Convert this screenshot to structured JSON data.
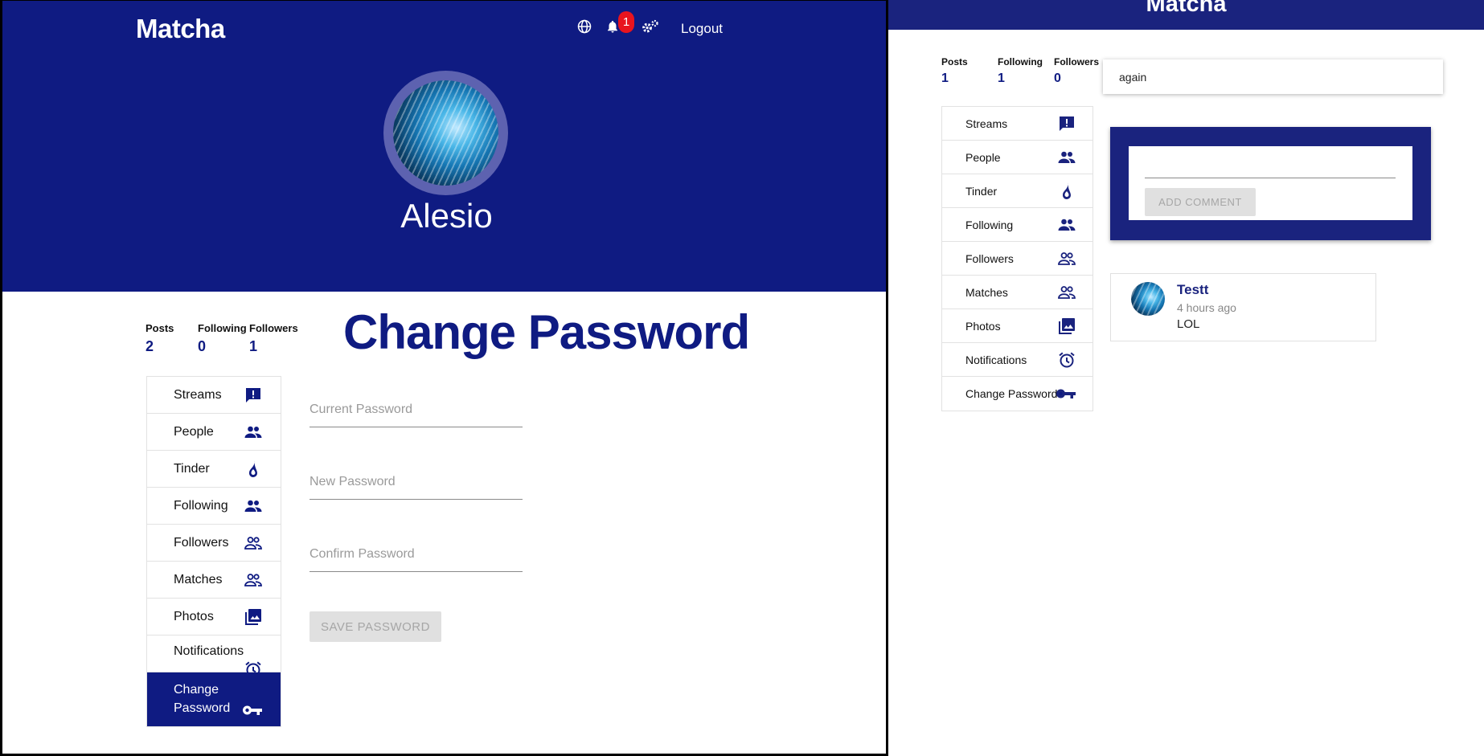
{
  "colors": {
    "primary": "#0f1b82",
    "primary_alt": "#1a237e",
    "badge": "#e8141e",
    "disabled_bg": "#e0e0e0"
  },
  "left": {
    "header": {
      "brand": "Matcha",
      "icons": [
        "globe-icon",
        "bell-icon",
        "settings-icon"
      ],
      "notification_count": "1",
      "logout_label": "Logout"
    },
    "profile": {
      "username": "Alesio"
    },
    "stats": {
      "posts_label": "Posts",
      "posts_value": "2",
      "following_label": "Following",
      "following_value": "0",
      "followers_label": "Followers",
      "followers_value": "1"
    },
    "menu": [
      {
        "label": "Streams",
        "icon": "feedback-icon"
      },
      {
        "label": "People",
        "icon": "people-icon"
      },
      {
        "label": "Tinder",
        "icon": "flame-icon"
      },
      {
        "label": "Following",
        "icon": "people-icon"
      },
      {
        "label": "Followers",
        "icon": "people-outline-icon"
      },
      {
        "label": "Matches",
        "icon": "people-outline-icon"
      },
      {
        "label": "Photos",
        "icon": "photo-library-icon"
      },
      {
        "label": "Notifications",
        "icon": "alarm-icon"
      },
      {
        "label": "Change Password",
        "icon": "key-icon",
        "active": true
      }
    ],
    "form": {
      "title": "Change Password",
      "current_placeholder": "Current Password",
      "new_placeholder": "New Password",
      "confirm_placeholder": "Confirm Password",
      "save_label": "SAVE PASSWORD"
    }
  },
  "right": {
    "header": {
      "brand": "Matcha"
    },
    "stats": {
      "posts_label": "Posts",
      "posts_value": "1",
      "following_label": "Following",
      "following_value": "1",
      "followers_label": "Followers",
      "followers_value": "0"
    },
    "menu": [
      {
        "label": "Streams",
        "icon": "feedback-icon"
      },
      {
        "label": "People",
        "icon": "people-icon"
      },
      {
        "label": "Tinder",
        "icon": "flame-icon"
      },
      {
        "label": "Following",
        "icon": "people-icon"
      },
      {
        "label": "Followers",
        "icon": "people-outline-icon"
      },
      {
        "label": "Matches",
        "icon": "people-outline-icon"
      },
      {
        "label": "Photos",
        "icon": "photo-library-icon"
      },
      {
        "label": "Notifications",
        "icon": "alarm-icon"
      },
      {
        "label": "Change Password",
        "icon": "key-icon"
      }
    ],
    "search": {
      "value": "again"
    },
    "comment": {
      "value": "",
      "button_label": "ADD COMMENT"
    },
    "post": {
      "author": "Testt",
      "time": "4 hours ago",
      "text": "LOL"
    }
  }
}
